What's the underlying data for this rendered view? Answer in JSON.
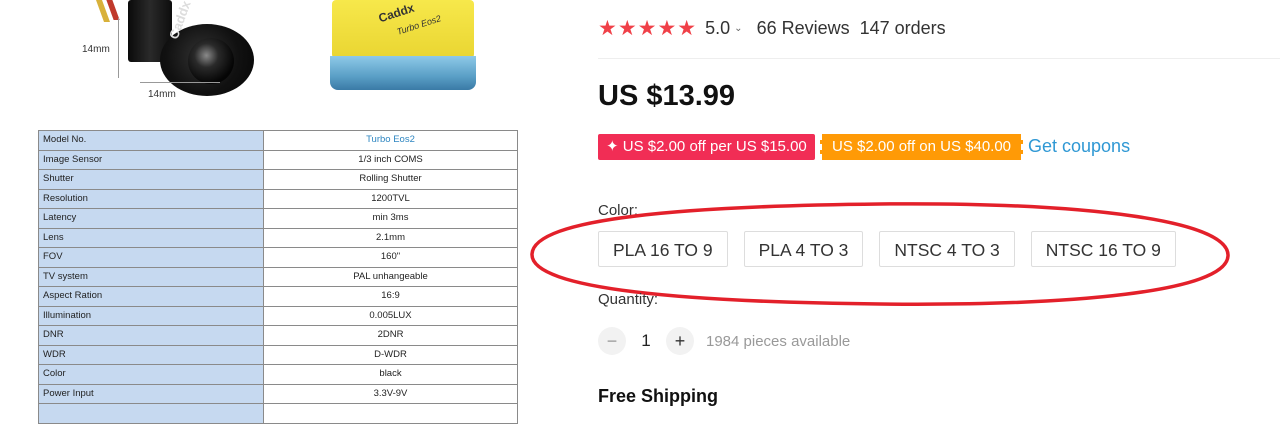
{
  "images": {
    "camera_brand": "Caddx",
    "camera_dim_height": "14mm",
    "camera_dim_width": "14mm",
    "box_brand": "Caddx",
    "box_model": "Turbo Eos2"
  },
  "spec_table": {
    "rows": [
      {
        "key": "Model No.",
        "value": "Turbo Eos2"
      },
      {
        "key": "Image Sensor",
        "value": "1/3 inch COMS"
      },
      {
        "key": "Shutter",
        "value": "Rolling Shutter"
      },
      {
        "key": "Resolution",
        "value": "1200TVL"
      },
      {
        "key": "Latency",
        "value": "min 3ms"
      },
      {
        "key": "Lens",
        "value": "2.1mm"
      },
      {
        "key": "FOV",
        "value": "160\""
      },
      {
        "key": "TV system",
        "value": "PAL unhangeable"
      },
      {
        "key": "Aspect Ration",
        "value": "16:9"
      },
      {
        "key": "Illumination",
        "value": "0.005LUX"
      },
      {
        "key": "DNR",
        "value": "2DNR"
      },
      {
        "key": "WDR",
        "value": "D-WDR"
      },
      {
        "key": "Color",
        "value": "black"
      },
      {
        "key": "Power Input",
        "value": "3.3V-9V"
      }
    ]
  },
  "product": {
    "stars": "★★★★★",
    "rating": "5.0",
    "reviews": "66 Reviews",
    "orders": "147 orders",
    "price": "US $13.99",
    "coupon_1": "✦ US $2.00 off per US $15.00",
    "coupon_2": "US $2.00 off on US $40.00",
    "get_coupons": "Get coupons",
    "color_label": "Color:",
    "color_options": [
      "PLA 16 TO 9",
      "PLA 4 TO 3",
      "NTSC 4 TO 3",
      "NTSC 16 TO 9"
    ],
    "quantity_label": "Quantity:",
    "quantity_minus": "−",
    "quantity_value": "1",
    "quantity_plus": "+",
    "available": "1984 pieces available",
    "shipping": "Free Shipping"
  },
  "colors": {
    "star": "#f04048",
    "coupon_red": "#f12d55",
    "coupon_orange": "#ff9a06",
    "link": "#2f98d4",
    "highlight_ellipse": "#e3202a",
    "table_key_bg": "#c6d9f0"
  }
}
